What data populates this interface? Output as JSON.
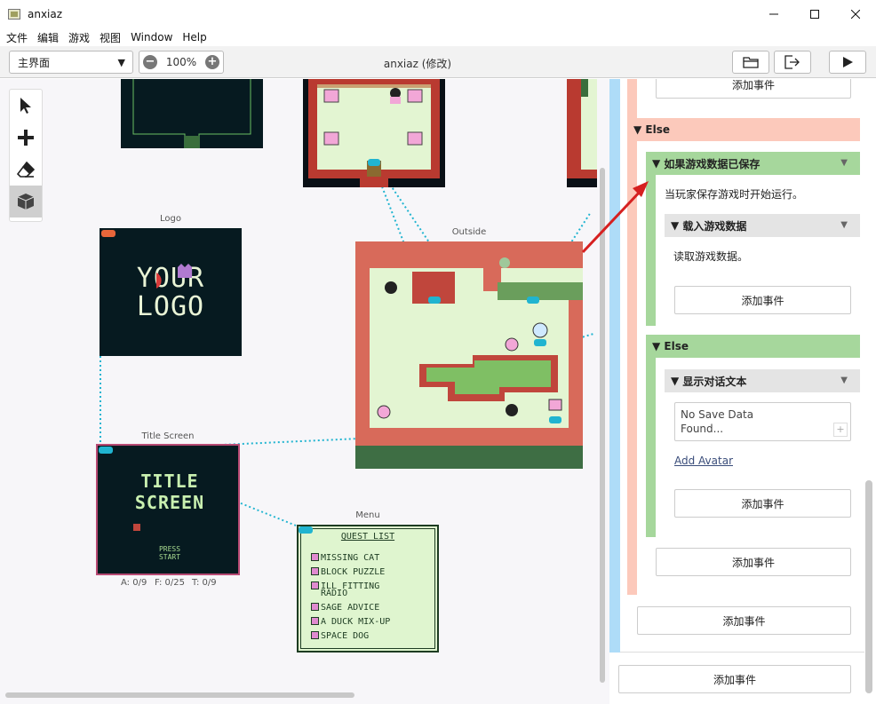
{
  "window": {
    "title": "anxiaz"
  },
  "menus": [
    "文件",
    "编辑",
    "游戏",
    "视图",
    "Window",
    "Help"
  ],
  "toolbar": {
    "scene_select": "主界面",
    "zoom": "100%",
    "doc_title": "anxiaz (修改)"
  },
  "scenes": {
    "logo": {
      "label": "Logo",
      "line1": "YOUR",
      "line2": "LOGO"
    },
    "outside": {
      "label": "Outside"
    },
    "title_screen": {
      "label": "Title Screen",
      "line1": "TITLE",
      "line2": "SCREEN",
      "press_line1": "PRESS",
      "press_line2": "START",
      "stat_actors": "A: 0/9",
      "stat_frames": "F: 0/25",
      "stat_triggers": "T: 0/9"
    },
    "menu": {
      "label": "Menu",
      "title": "QUEST LIST",
      "items": [
        "MISSING CAT",
        "BLOCK PUZZLE",
        "ILL FITTING",
        "RADIO",
        "SAGE ADVICE",
        "A DUCK MIX-UP",
        "SPACE DOG"
      ]
    }
  },
  "panel": {
    "top_add_label": "添加事件",
    "else1": "Else",
    "if_saved": "如果游戏数据已保存",
    "if_saved_desc": "当玩家保存游戏时开始运行。",
    "load_data": "载入游戏数据",
    "load_data_desc": "读取游戏数据。",
    "add_event_1": "添加事件",
    "else2": "Else",
    "show_dialog": "显示对话文本",
    "dialog_line1": "No Save Data",
    "dialog_line2": "Found...",
    "add_avatar": "Add Avatar",
    "add_event_2": "添加事件",
    "add_event_3": "添加事件",
    "add_event_4": "添加事件",
    "add_event_5": "添加事件"
  },
  "colors": {
    "accent_blue": "#20b4d0",
    "salmon": "#fcc9bb",
    "green": "#a6d79c",
    "rail_blue": "#aedcf8"
  }
}
